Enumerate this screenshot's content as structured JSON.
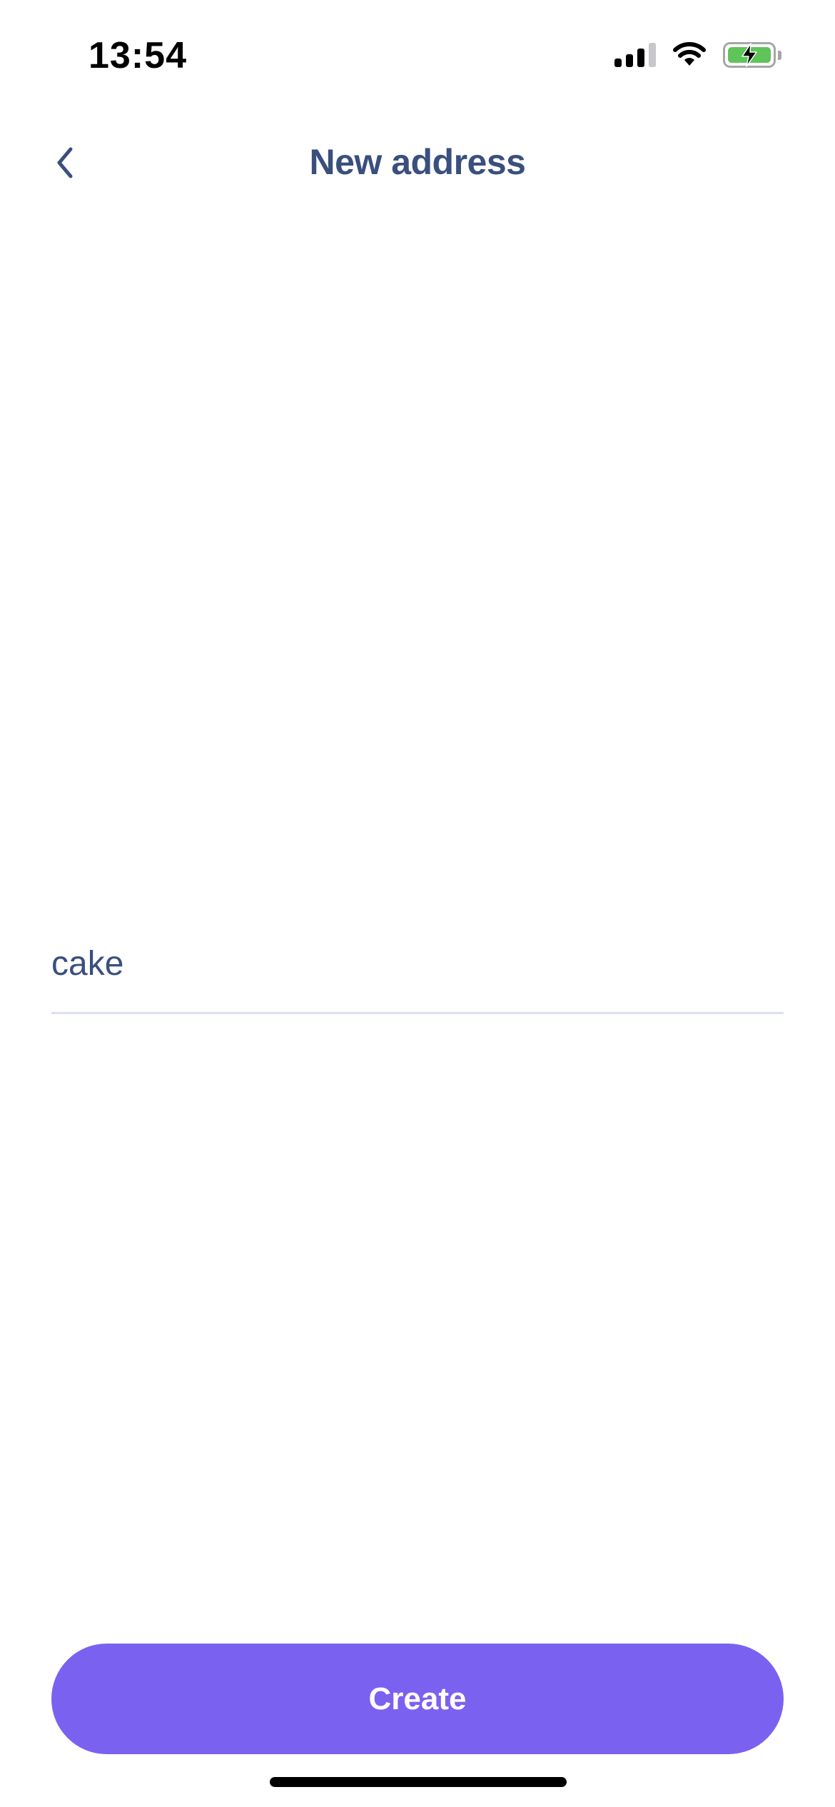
{
  "status_bar": {
    "time": "13:54",
    "icons": [
      "cellular-signal-icon",
      "wifi-icon",
      "battery-charging-icon"
    ]
  },
  "nav": {
    "title": "New address",
    "back_icon": "chevron-left-icon"
  },
  "form": {
    "address_value": "cake"
  },
  "actions": {
    "create_label": "Create"
  },
  "colors": {
    "title": "#3a4f7e",
    "accent": "#7b61f0",
    "input_underline": "#dcdff5",
    "battery_fill": "#5fc45a"
  }
}
